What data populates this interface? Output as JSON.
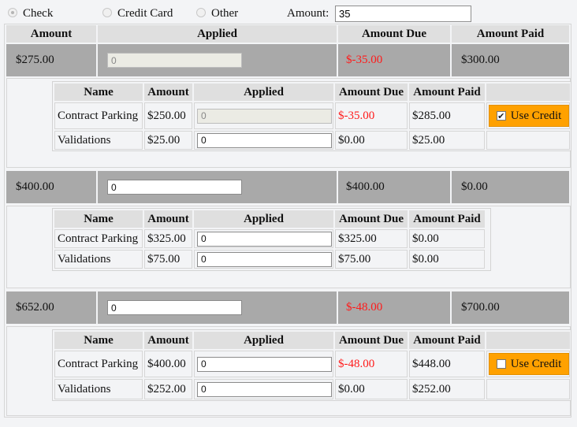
{
  "payment_methods": [
    {
      "label": "Check",
      "selected": true
    },
    {
      "label": "Credit Card",
      "selected": false
    },
    {
      "label": "Other",
      "selected": false
    }
  ],
  "amount": {
    "label": "Amount:",
    "value": "35"
  },
  "main_headers": [
    "Amount",
    "Applied",
    "Amount Due",
    "Amount Paid"
  ],
  "sub_headers": [
    "Name",
    "Amount",
    "Applied",
    "Amount Due",
    "Amount Paid"
  ],
  "groups": [
    {
      "amount": "$275.00",
      "applied": "0",
      "applied_disabled": true,
      "amount_due": "$-35.00",
      "amount_due_negative": true,
      "amount_paid": "$300.00",
      "items": [
        {
          "name": "Contract Parking",
          "amount": "$250.00",
          "applied": "0",
          "applied_disabled": true,
          "amount_due": "$-35.00",
          "amount_due_negative": true,
          "amount_paid": "$285.00",
          "use_credit": {
            "label": "Use Credit",
            "checked": true
          }
        },
        {
          "name": "Validations",
          "amount": "$25.00",
          "applied": "0",
          "applied_disabled": false,
          "amount_due": "$0.00",
          "amount_due_negative": false,
          "amount_paid": "$25.00"
        }
      ]
    },
    {
      "amount": "$400.00",
      "applied": "0",
      "applied_disabled": false,
      "amount_due": "$400.00",
      "amount_due_negative": false,
      "amount_paid": "$0.00",
      "items": [
        {
          "name": "Contract Parking",
          "amount": "$325.00",
          "applied": "0",
          "applied_disabled": false,
          "amount_due": "$325.00",
          "amount_due_negative": false,
          "amount_paid": "$0.00"
        },
        {
          "name": "Validations",
          "amount": "$75.00",
          "applied": "0",
          "applied_disabled": false,
          "amount_due": "$75.00",
          "amount_due_negative": false,
          "amount_paid": "$0.00"
        }
      ]
    },
    {
      "amount": "$652.00",
      "applied": "0",
      "applied_disabled": false,
      "amount_due": "$-48.00",
      "amount_due_negative": true,
      "amount_paid": "$700.00",
      "items": [
        {
          "name": "Contract Parking",
          "amount": "$400.00",
          "applied": "0",
          "applied_disabled": false,
          "amount_due": "$-48.00",
          "amount_due_negative": true,
          "amount_paid": "$448.00",
          "use_credit": {
            "label": "Use Credit",
            "checked": false
          }
        },
        {
          "name": "Validations",
          "amount": "$252.00",
          "applied": "0",
          "applied_disabled": false,
          "amount_due": "$0.00",
          "amount_due_negative": false,
          "amount_paid": "$252.00"
        }
      ]
    }
  ],
  "colors": {
    "negative": "#ff1a1a",
    "credit_button": "#ffa100",
    "row_grey": "#a9a9a9",
    "header_grey": "#dfdfdf"
  }
}
